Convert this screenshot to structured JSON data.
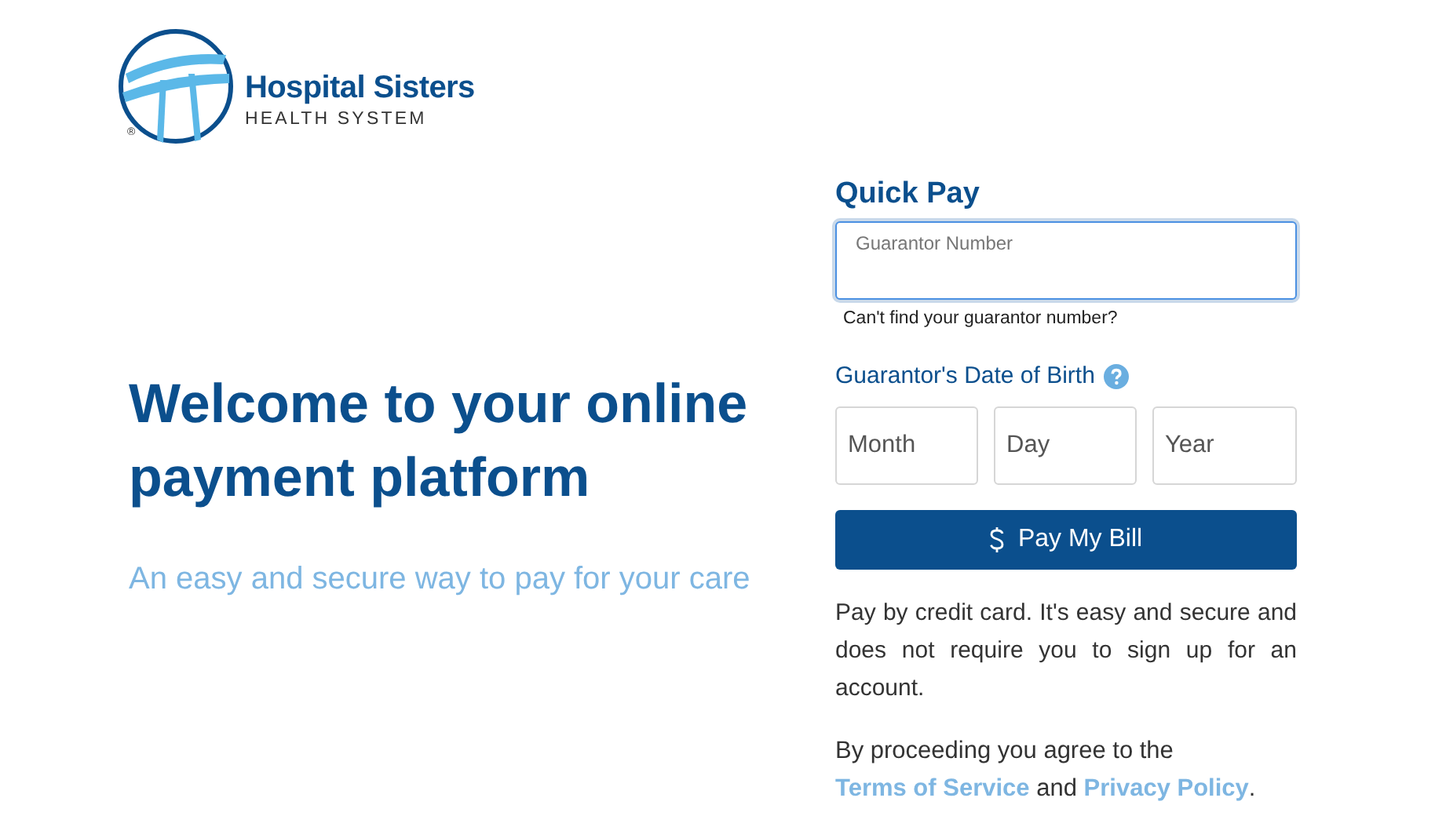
{
  "logo": {
    "name": "Hospital Sisters",
    "tagline": "HEALTH SYSTEM",
    "mark": "®"
  },
  "hero": {
    "heading": "Welcome to your online payment platform",
    "subheading": "An easy and secure way to pay for your care"
  },
  "quick_pay": {
    "title": "Quick Pay",
    "guarantor_field": {
      "placeholder": "Guarantor Number",
      "focused": true
    },
    "help_link": "Can't find your guarantor number?",
    "dob_label": "Guarantor's Date of Birth",
    "dob_fields": [
      {
        "placeholder": "Month"
      },
      {
        "placeholder": "Day"
      },
      {
        "placeholder": "Year"
      }
    ],
    "button": {
      "label": "Pay My Bill"
    },
    "description": "Pay by credit card. It's easy and secure and does not require you to sign up for an account.",
    "agreement": {
      "prefix": "By proceeding you agree to the",
      "terms_link": "Terms of Service",
      "middle": "and",
      "privacy_link": "Privacy Policy",
      "suffix": "."
    }
  }
}
